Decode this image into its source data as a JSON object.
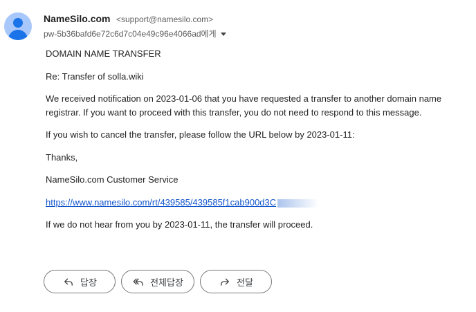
{
  "sender": {
    "name": "NameSilo.com",
    "email": "<support@namesilo.com>"
  },
  "recipient": {
    "text": "pw-5b36bafd6e72c6d7c04e49c96e4066ad에게"
  },
  "message": {
    "heading": "DOMAIN NAME TRANSFER",
    "subject_line": "Re: Transfer of solla.wiki",
    "paragraph1": "We received notification on 2023-01-06 that you have requested a transfer to another domain name registrar. If you want to proceed with this transfer, you do not need to respond to this message.",
    "paragraph2": "If you wish to cancel the transfer, please follow the URL below by 2023-01-11:",
    "thanks": "Thanks,",
    "signature": "NameSilo.com Customer Service",
    "link_text": "https://www.namesilo.com/rt/439585/439585f1cab900d3C",
    "closing": "If we do not hear from you by 2023-01-11, the transfer will proceed."
  },
  "actions": {
    "reply_label": "답장",
    "reply_all_label": "전체답장",
    "forward_label": "전달"
  },
  "colors": {
    "link": "#1155cc",
    "avatar_bg": "#a8c7fa",
    "avatar_fg": "#1a73e8"
  },
  "icons": {
    "avatar": "person-icon",
    "caret": "chevron-down-icon",
    "reply": "reply-icon",
    "reply_all": "reply-all-icon",
    "forward": "forward-icon"
  }
}
